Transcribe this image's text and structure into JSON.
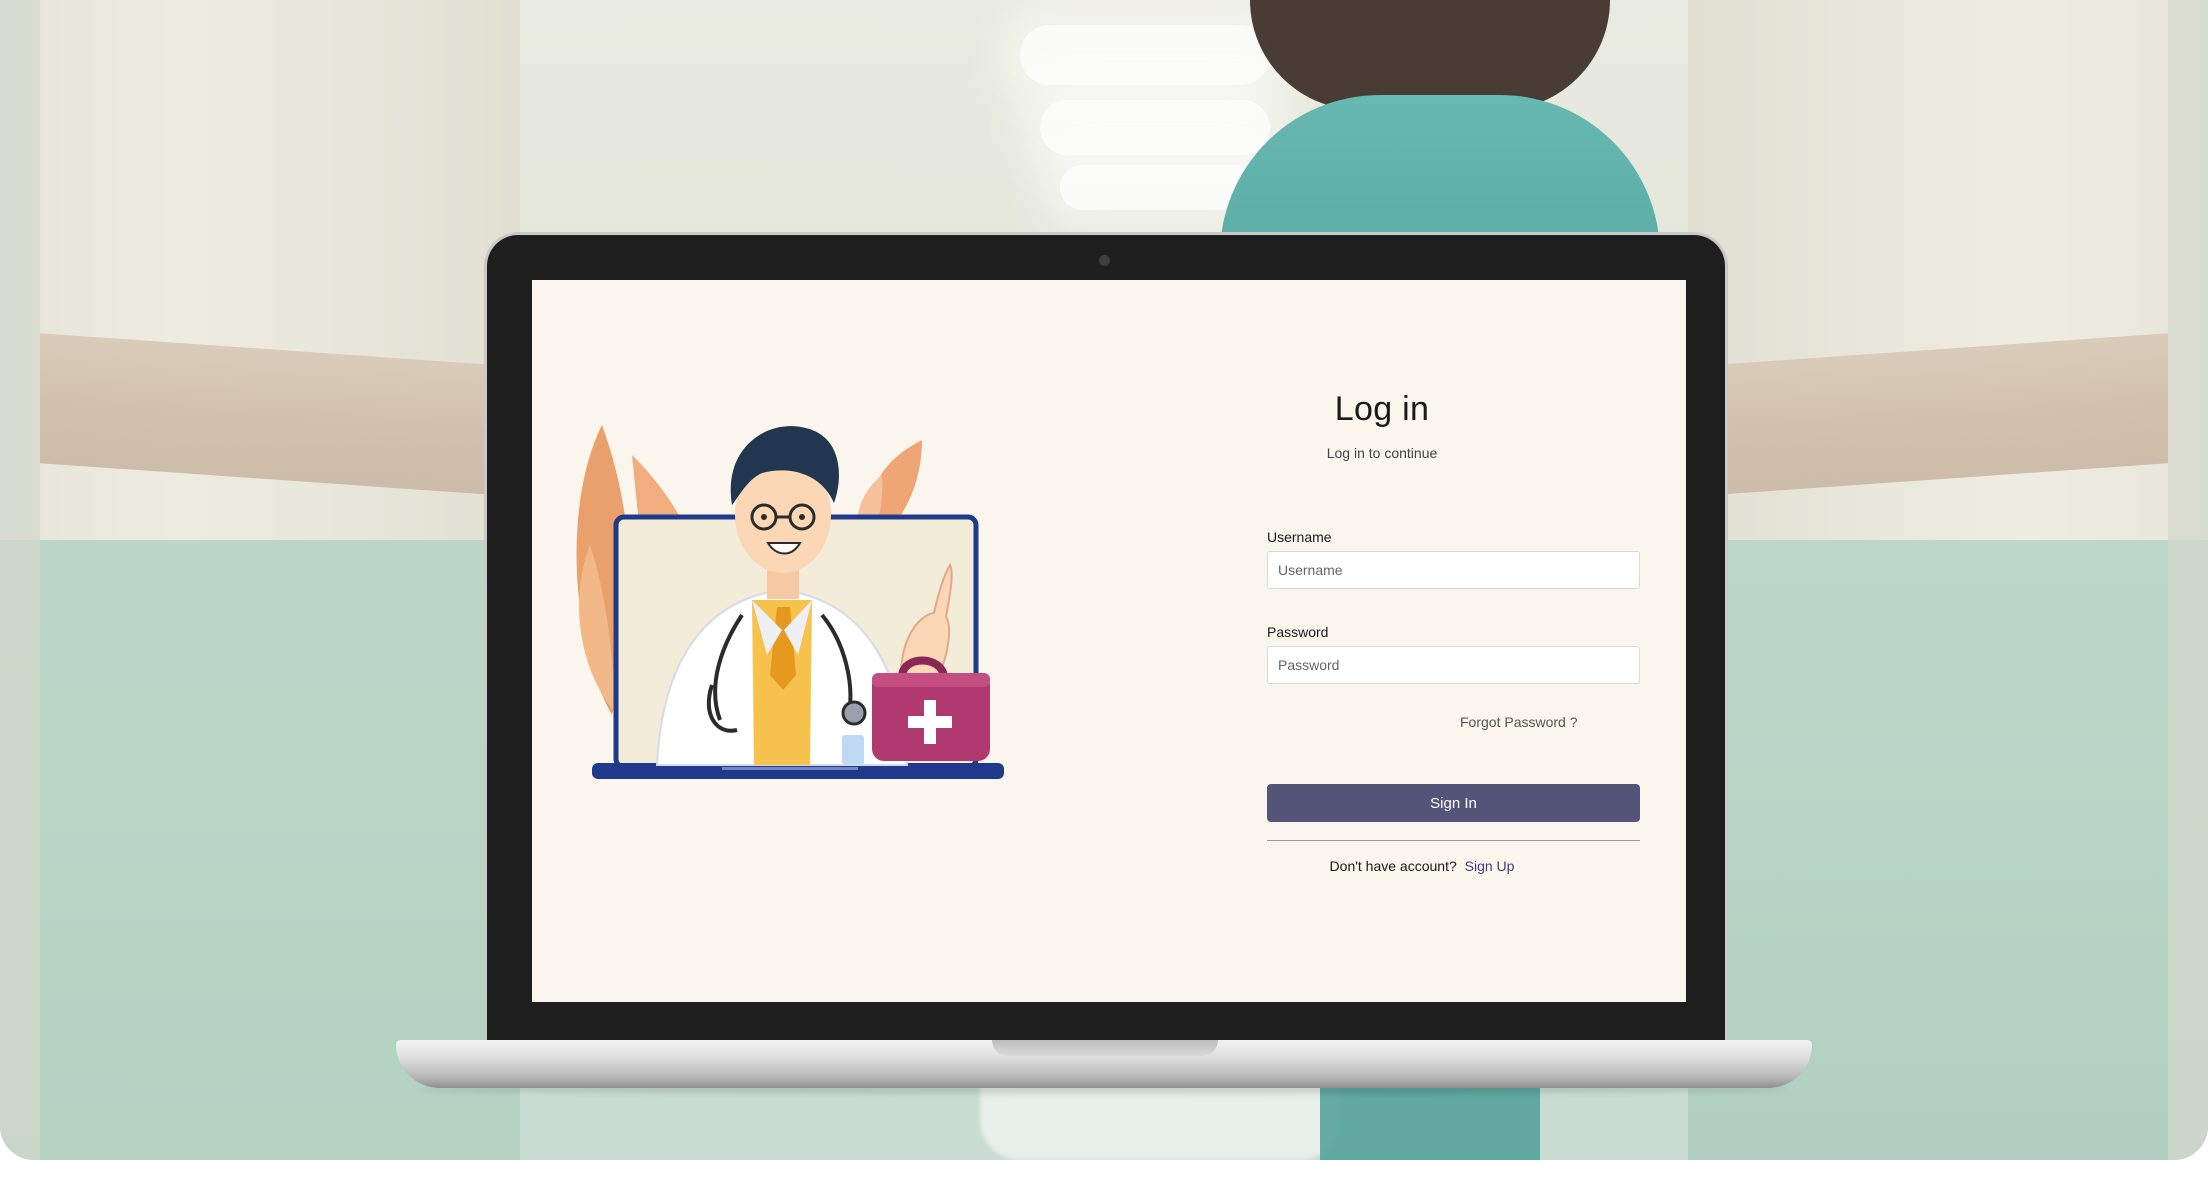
{
  "login": {
    "title": "Log in",
    "subtitle": "Log in to continue",
    "username_label": "Username",
    "username_placeholder": "Username",
    "username_value": "",
    "password_label": "Password",
    "password_placeholder": "Password",
    "password_value": "",
    "forgot_password": "Forgot Password ?",
    "sign_in_label": "Sign In",
    "no_account_text": "Don't have account?",
    "sign_up_label": "Sign Up"
  },
  "icons": {
    "illustration": "doctor-on-laptop-illustration",
    "camera": "webcam-dot-icon",
    "medical_kit": "medical-kit-icon"
  },
  "colors": {
    "screen_bg": "#faf6ee",
    "button_bg": "#535478",
    "link": "#3d3f7a",
    "laptop_bezel": "#1e1e1e",
    "kit": "#b03a6f",
    "leaves": "#f0a574"
  }
}
